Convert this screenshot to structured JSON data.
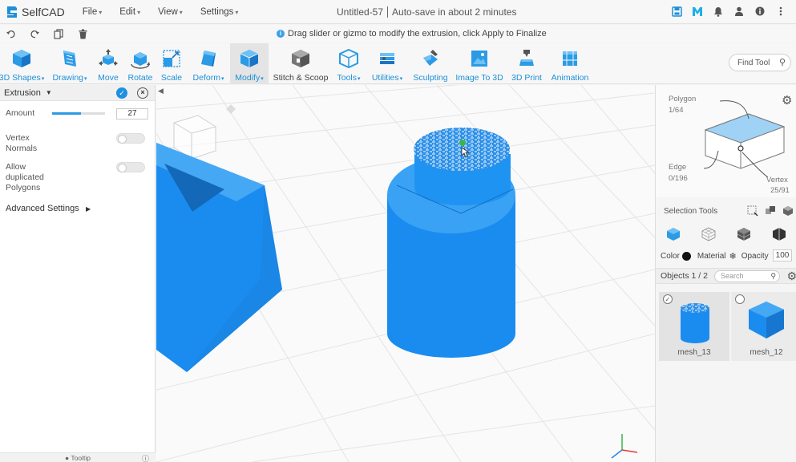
{
  "app": {
    "logo_text": "SelfCAD",
    "menu": [
      "File",
      "Edit",
      "View",
      "Settings"
    ],
    "doc_title": "Untitled-57",
    "autosave": "Auto-save in about 2 minutes",
    "hint": "Drag slider or gizmo to modify the extrusion, click Apply to Finalize"
  },
  "menubar_icons": [
    "save-icon",
    "m-logo-icon",
    "bell-icon",
    "user-icon",
    "info-icon",
    "more-icon"
  ],
  "quick_actions": [
    "undo-icon",
    "redo-icon",
    "copy-icon",
    "delete-icon"
  ],
  "toolbar": {
    "tools": [
      {
        "label": "3D Shapes",
        "dropdown": true
      },
      {
        "label": "Drawing",
        "dropdown": true
      },
      {
        "label": "Move",
        "dropdown": false
      },
      {
        "label": "Rotate",
        "dropdown": false
      },
      {
        "label": "Scale",
        "dropdown": false
      },
      {
        "label": "Deform",
        "dropdown": true
      },
      {
        "label": "Modify",
        "dropdown": true
      },
      {
        "label": "Stitch & Scoop",
        "dropdown": false
      },
      {
        "label": "Tools",
        "dropdown": true
      },
      {
        "label": "Utilities",
        "dropdown": true
      },
      {
        "label": "Sculpting",
        "dropdown": false
      },
      {
        "label": "Image To 3D",
        "dropdown": false
      },
      {
        "label": "3D Print",
        "dropdown": false
      },
      {
        "label": "Animation",
        "dropdown": false
      }
    ],
    "find_tool_placeholder": "Find Tool"
  },
  "extrusion_panel": {
    "title": "Extrusion",
    "amount_label": "Amount",
    "amount_value": "27",
    "amount_slider_fraction": 0.55,
    "vertex_normals_label_1": "Vertex",
    "vertex_normals_label_2": "Normals",
    "allow_dup_label_1": "Allow",
    "allow_dup_label_2": "duplicated",
    "allow_dup_label_3": "Polygons",
    "advanced_settings": "Advanced Settings",
    "tooltip": "Tooltip"
  },
  "right_panel": {
    "polygon_label": "Polygon",
    "polygon_count": "1/64",
    "edge_label": "Edge",
    "edge_count": "0/196",
    "vertex_label": "Vertex",
    "vertex_count": "25/91",
    "selection_tools": "Selection Tools",
    "color_label": "Color",
    "material_label": "Material",
    "opacity_label": "Opacity",
    "opacity_value": "100",
    "objects_label": "Objects 1 / 2",
    "search_placeholder": "Search",
    "objects": [
      {
        "name": "mesh_13",
        "selected": true
      },
      {
        "name": "mesh_12",
        "selected": false
      }
    ]
  },
  "colors": {
    "accent": "#1e8fd8",
    "object_blue": "#1a8cf0",
    "panel_bg": "#f7f7f7"
  }
}
